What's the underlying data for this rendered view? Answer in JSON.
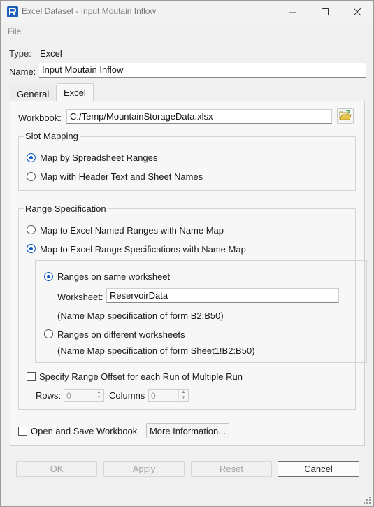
{
  "window": {
    "title": "Excel Dataset - Input Moutain Inflow"
  },
  "menu": {
    "file": "File"
  },
  "header": {
    "type_label": "Type:",
    "type_value": "Excel",
    "name_label": "Name:",
    "name_value": "Input Moutain Inflow"
  },
  "tabs": [
    {
      "label": "General",
      "active": false
    },
    {
      "label": "Excel",
      "active": true
    }
  ],
  "workbook": {
    "label": "Workbook:",
    "path": "C:/Temp/MountainStorageData.xlsx"
  },
  "slot_mapping": {
    "title": "Slot Mapping",
    "options": [
      {
        "label": "Map by Spreadsheet Ranges",
        "selected": true
      },
      {
        "label": "Map with Header Text and Sheet Names",
        "selected": false
      }
    ]
  },
  "range_spec": {
    "title": "Range Specification",
    "options": [
      {
        "label": "Map to Excel Named Ranges with Name Map",
        "selected": false
      },
      {
        "label": "Map to Excel Range Specifications with Name Map",
        "selected": true
      }
    ],
    "sub": {
      "same_label": "Ranges on same worksheet",
      "same_selected": true,
      "worksheet_label": "Worksheet:",
      "worksheet_value": "ReservoirData",
      "same_hint": "(Name Map specification of form B2:B50)",
      "diff_label": "Ranges on different worksheets",
      "diff_selected": false,
      "diff_hint": "(Name Map specification of form Sheet1!B2:B50)"
    },
    "offset_label": "Specify Range Offset for each Run of Multiple Run",
    "offset_checked": false,
    "rows_label": "Rows:",
    "rows_value": "0",
    "columns_label": "Columns",
    "columns_value": "0"
  },
  "footer": {
    "open_save_label": "Open and Save Workbook",
    "open_save_checked": false,
    "more_info": "More Information..."
  },
  "buttons": {
    "ok": "OK",
    "apply": "Apply",
    "reset": "Reset",
    "cancel": "Cancel"
  },
  "colors": {
    "accent": "#0a59c2",
    "app_icon": "#1b5fb8"
  }
}
